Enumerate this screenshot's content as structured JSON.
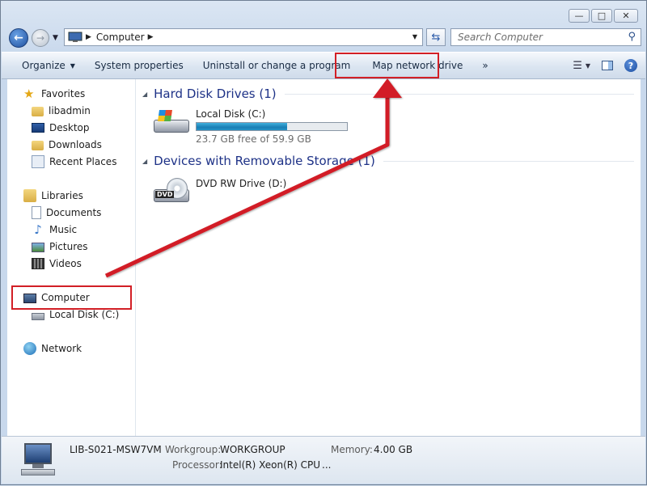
{
  "window": {
    "caption_buttons": [
      "minimize",
      "maximize",
      "close"
    ]
  },
  "nav": {
    "breadcrumb": "Computer",
    "search_placeholder": "Search Computer"
  },
  "toolbar": {
    "organize": "Organize",
    "system_properties": "System properties",
    "uninstall": "Uninstall or change a program",
    "map_network_drive": "Map network drive",
    "more": "»"
  },
  "sidebar": {
    "favorites": "Favorites",
    "favorites_items": [
      "libadmin",
      "Desktop",
      "Downloads",
      "Recent Places"
    ],
    "libraries": "Libraries",
    "libraries_items": [
      "Documents",
      "Music",
      "Pictures",
      "Videos"
    ],
    "computer": "Computer",
    "computer_items": [
      "Local Disk (C:)"
    ],
    "network": "Network"
  },
  "content": {
    "hard_disk_header": "Hard Disk Drives (1)",
    "local_disk": {
      "name": "Local Disk (C:)",
      "free_text": "23.7 GB free of 59.9 GB",
      "used_fraction": 0.604
    },
    "removable_header": "Devices with Removable Storage (1)",
    "dvd": {
      "name": "DVD RW Drive (D:)",
      "badge": "DVD"
    }
  },
  "details": {
    "computer_name": "LIB-S021-MSW7VM",
    "workgroup_label": "Workgroup:",
    "workgroup_value": "WORKGROUP",
    "memory_label": "Memory:",
    "memory_value": "4.00 GB",
    "processor_label": "Processor:",
    "processor_value": "Intel(R) Xeon(R) CPU",
    "ellipsis": "..."
  },
  "colors": {
    "annotation_red": "#d21f26",
    "header_blue": "#1e3287",
    "bar_fill": "#1a7fb5"
  }
}
